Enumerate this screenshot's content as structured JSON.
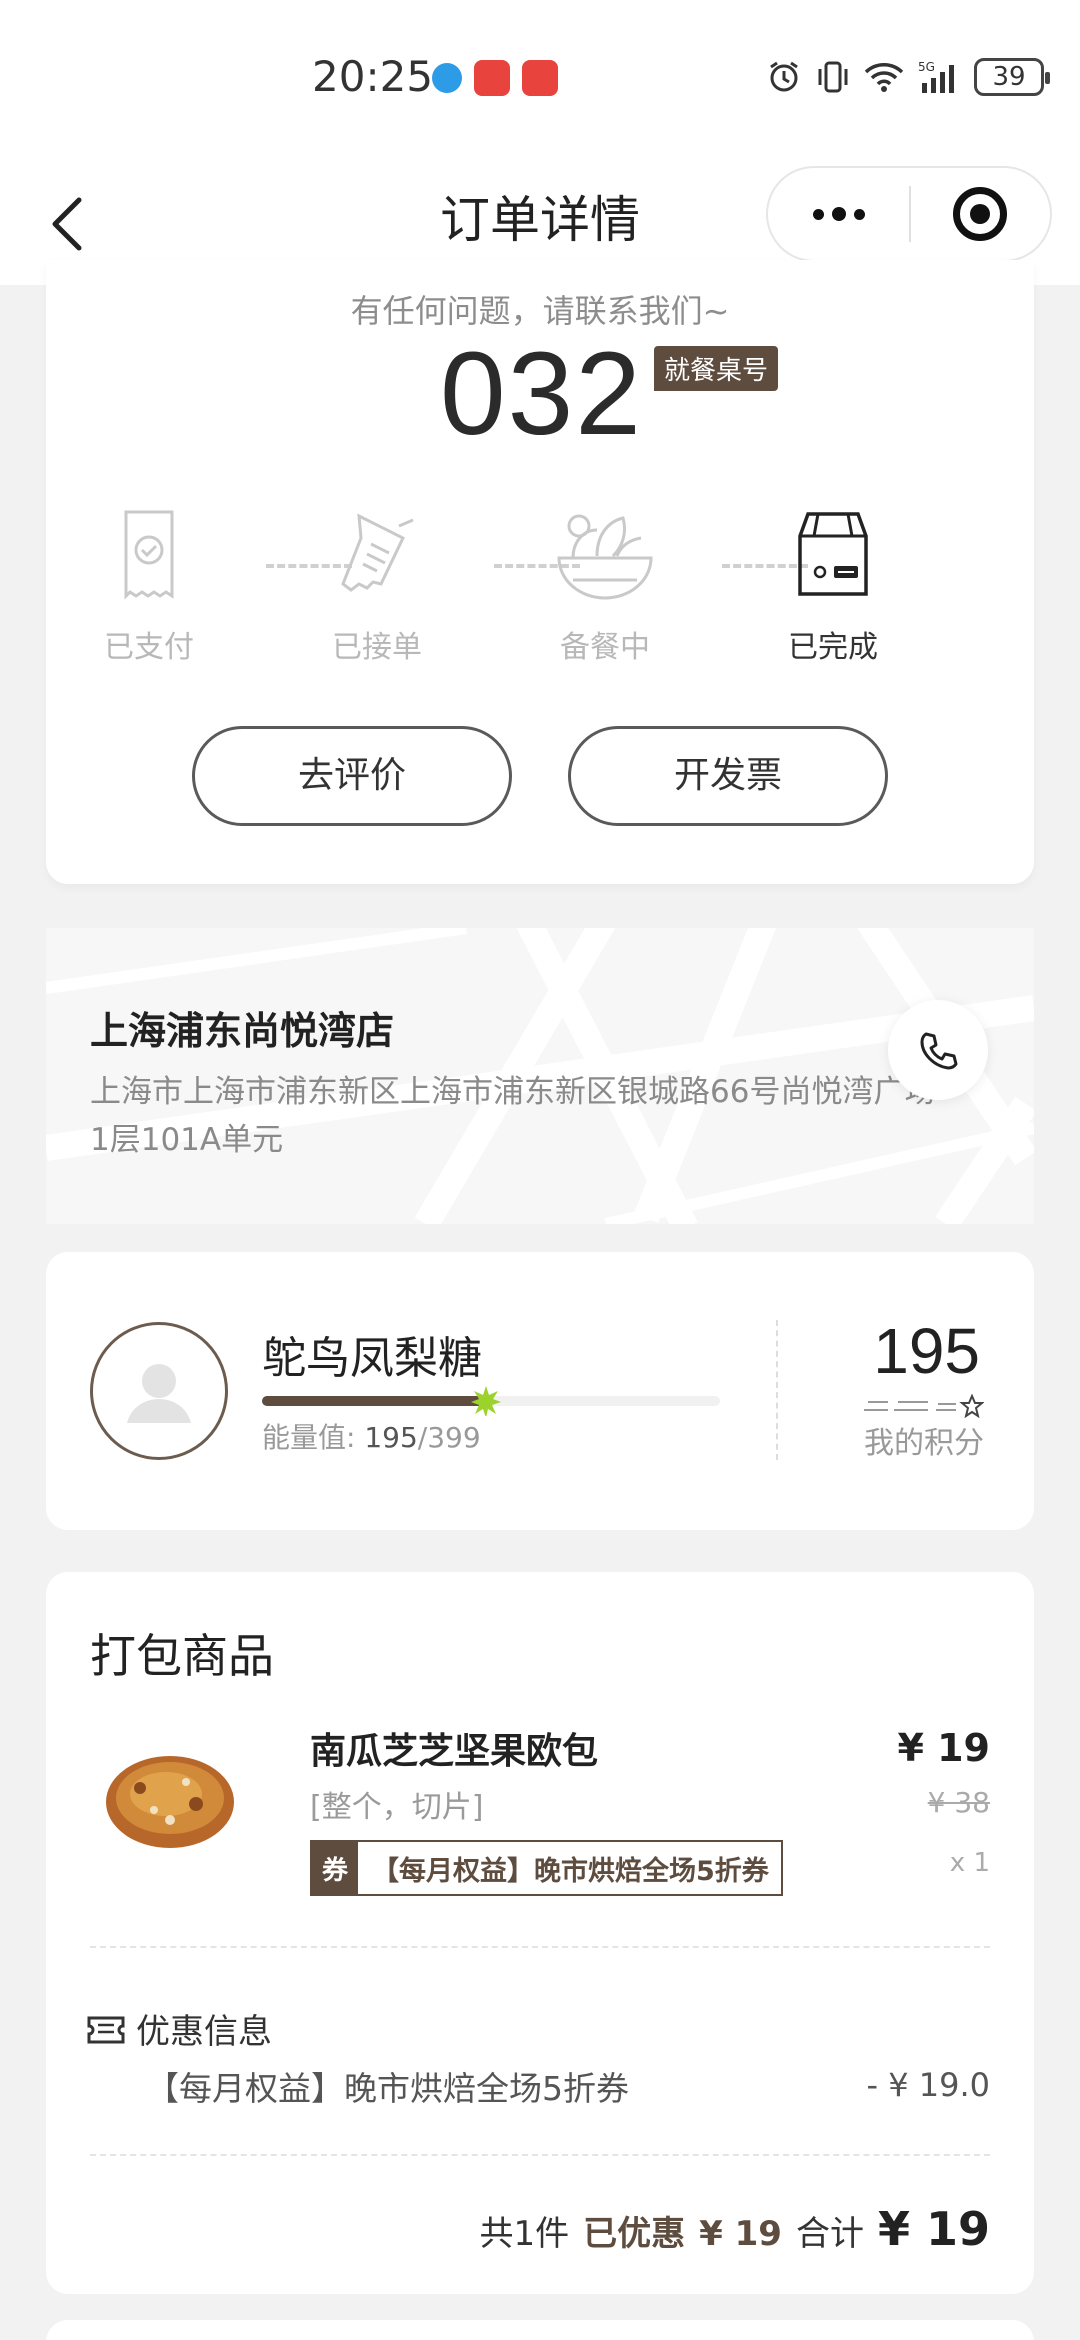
{
  "status_bar": {
    "time": "20:25",
    "battery": "39"
  },
  "nav": {
    "title": "订单详情"
  },
  "order_status": {
    "contact_tip": "有任何问题，请联系我们~",
    "table_number": "032",
    "table_tag": "就餐桌号",
    "steps": [
      {
        "label": "已支付",
        "icon": "receipt-check-icon",
        "active": false
      },
      {
        "label": "已接单",
        "icon": "receipt-pen-icon",
        "active": false
      },
      {
        "label": "备餐中",
        "icon": "food-bowl-icon",
        "active": false
      },
      {
        "label": "已完成",
        "icon": "bag-icon",
        "active": true
      }
    ],
    "actions": {
      "review": "去评价",
      "invoice": "开发票"
    }
  },
  "store": {
    "name": "上海浦东尚悦湾店",
    "address": "上海市上海市浦东新区上海市浦东新区银城路66号尚悦湾广场1层101A单元"
  },
  "member": {
    "name": "鸵鸟凤梨糖",
    "energy_label": "能量值:",
    "energy_current": "195",
    "energy_total": "/399",
    "energy_progress": 0.49,
    "points": "195",
    "points_label": "我的积分"
  },
  "goods": {
    "title": "打包商品",
    "items": [
      {
        "name": "南瓜芝芝坚果欧包",
        "spec": "[整个，切片]",
        "coupon_tag": "券",
        "coupon_text": "【每月权益】晚市烘焙全场5折券",
        "price": "¥ 19",
        "original_price": "¥ 38",
        "quantity": "x 1"
      }
    ],
    "promo_header": "优惠信息",
    "promo_item": "【每月权益】晚市烘焙全场5折券",
    "promo_amount": "- ¥ 19.0",
    "total_count": "共1件",
    "discount_label": "已优惠",
    "discount_value": "¥ 19",
    "sum_label": "合计",
    "sum_value": "¥ 19"
  },
  "colors": {
    "brand": "#5e4d3f",
    "accent_spark": "#9bd22c",
    "muted_text": "#8d8d8d"
  }
}
